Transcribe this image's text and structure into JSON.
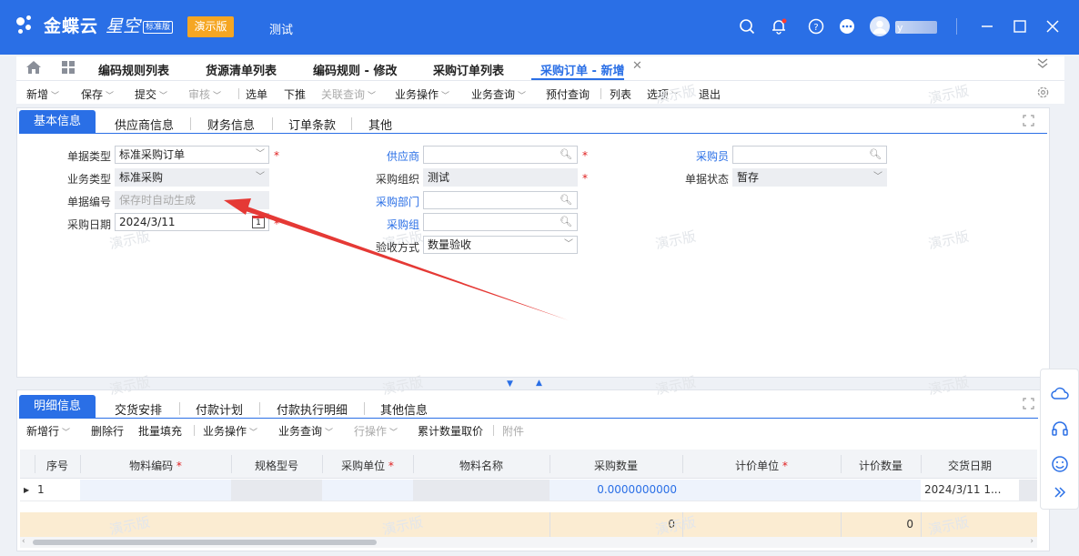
{
  "header": {
    "brand": "金蝶云",
    "brand_sub": "星空",
    "edition": "标准版",
    "demo_label": "演示版",
    "current_org": "测试",
    "user_name": "y"
  },
  "tabs": [
    {
      "label": "编码规则列表"
    },
    {
      "label": "货源清单列表"
    },
    {
      "label": "编码规则 - 修改"
    },
    {
      "label": "采购订单列表"
    },
    {
      "label": "采购订单 - 新增"
    }
  ],
  "toolbar": {
    "new": "新增",
    "save": "保存",
    "submit": "提交",
    "audit": "审核",
    "select_order": "选单",
    "push_down": "下推",
    "related_query": "关联查询",
    "biz_operation": "业务操作",
    "biz_query": "业务查询",
    "prepay_query": "预付查询",
    "list": "列表",
    "options": "选项",
    "exit": "退出"
  },
  "head_tabs": [
    "基本信息",
    "供应商信息",
    "财务信息",
    "订单条款",
    "其他"
  ],
  "form": {
    "bill_type_label": "单据类型",
    "bill_type_value": "标准采购订单",
    "biz_type_label": "业务类型",
    "biz_type_value": "标准采购",
    "bill_no_label": "单据编号",
    "bill_no_placeholder": "保存时自动生成",
    "date_label": "采购日期",
    "date_value": "2024/3/11",
    "supplier_label": "供应商",
    "supplier_value": "",
    "purchase_org_label": "采购组织",
    "purchase_org_value": "测试",
    "purchase_dept_label": "采购部门",
    "purchase_dept_value": "",
    "purchase_group_label": "采购组",
    "purchase_group_value": "",
    "accept_method_label": "验收方式",
    "accept_method_value": "数量验收",
    "buyer_label": "采购员",
    "buyer_value": "",
    "status_label": "单据状态",
    "status_value": "暂存",
    "calendar_day": "1"
  },
  "detail_tabs": [
    "明细信息",
    "交货安排",
    "付款计划",
    "付款执行明细",
    "其他信息"
  ],
  "detail_toolbar": {
    "add_row": "新增行",
    "delete_row": "删除行",
    "batch_fill": "批量填充",
    "biz_operation": "业务操作",
    "biz_query": "业务查询",
    "row_operation": "行操作",
    "cumulative_price": "累计数量取价",
    "attachment": "附件"
  },
  "grid": {
    "columns": [
      "序号",
      "物料编码",
      "规格型号",
      "采购单位",
      "物料名称",
      "采购数量",
      "计价单位",
      "计价数量",
      "交货日期"
    ],
    "rows": [
      {
        "seq": "1",
        "qty": "0.0000000000",
        "delivery_date": "2024/3/11 1..."
      }
    ],
    "sum_qty": "0",
    "sum_price_qty": "0"
  },
  "watermark": "演示版",
  "colors": {
    "primary": "#2a6fe6",
    "demo_badge": "#f5a623",
    "required": "#e02020",
    "arrow": "#e53935",
    "summary_row": "#fbecd2"
  }
}
